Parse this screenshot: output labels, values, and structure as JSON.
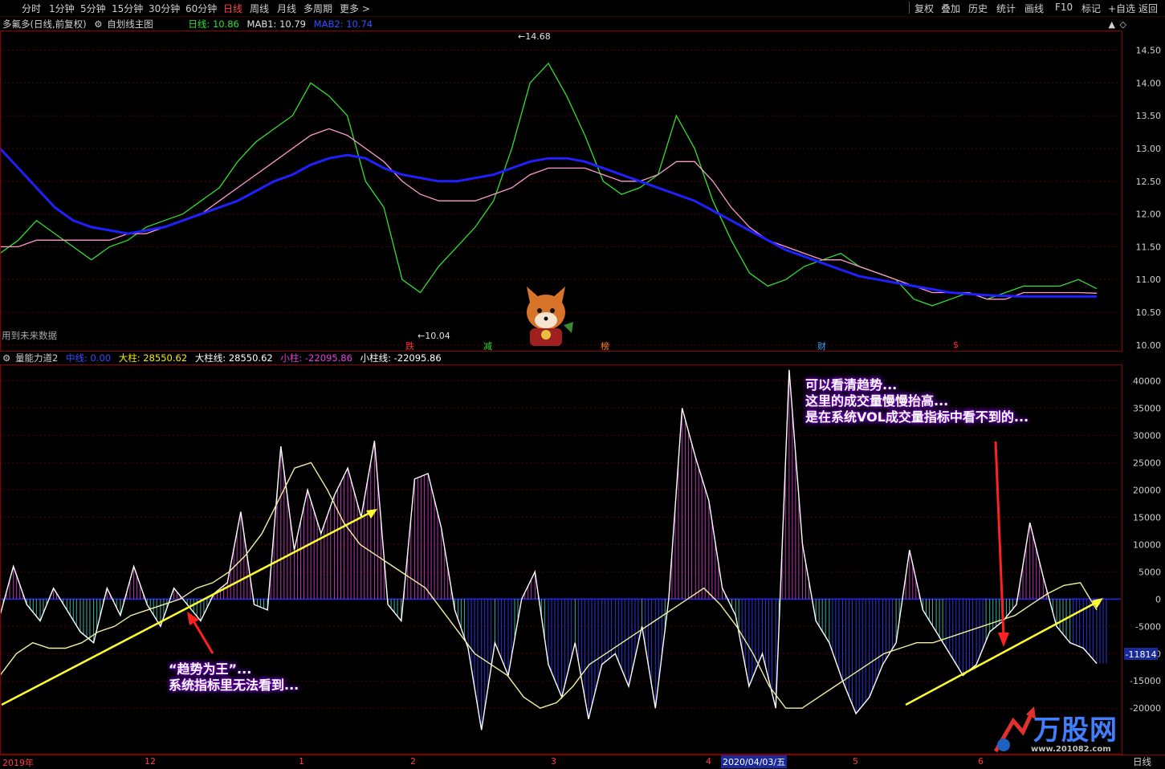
{
  "toolbar": {
    "periods": [
      "分时",
      "1分钟",
      "5分钟",
      "15分钟",
      "30分钟",
      "60分钟",
      "日线",
      "周线",
      "月线",
      "多周期",
      "更多 >"
    ],
    "active_period": "日线",
    "right_buttons": [
      "复权",
      "叠加",
      "历史",
      "统计",
      "画线",
      "F10",
      "标记",
      "+自选",
      "返回"
    ]
  },
  "stock": {
    "name": "多氟多(日线,前复权)",
    "main_indicator": "自划线主图",
    "line_label": "日线:",
    "line_value": "10.86",
    "mab1_label": "MAB1:",
    "mab1_value": "10.79",
    "mab2_label": "MAB2:",
    "mab2_value": "10.74",
    "future_data_note": "用到未来数据",
    "high_marker": "14.68",
    "low_marker": "10.04",
    "signals": [
      {
        "label": "跌",
        "color": "#ff3030"
      },
      {
        "label": "减",
        "color": "#30e030"
      },
      {
        "label": "榜",
        "color": "#ff8020"
      },
      {
        "label": "财",
        "color": "#40a0ff"
      },
      {
        "label": "$",
        "color": "#ff3030"
      }
    ]
  },
  "sub_indicator": {
    "name": "量能力道2",
    "zhong_label": "中线:",
    "zhong_value": "0.00",
    "dazhu_label": "大柱:",
    "dazhu_value": "28550.62",
    "dazhuxian_label": "大柱线:",
    "dazhuxian_value": "28550.62",
    "xiaozhu_label": "小柱:",
    "xiaozhu_value": "-22095.86",
    "xiaozhuxian_label": "小柱线:",
    "xiaozhuxian_value": "-22095.86",
    "current_value_tag": "-11814"
  },
  "annotations": {
    "left_line1": "“趋势为王”...",
    "left_line2": "系统指标里无法看到...",
    "right_line1": "可以看清趋势...",
    "right_line2": "这里的成交量慢慢抬高...",
    "right_line3": "是在系统VOL成交量指标中看不到的..."
  },
  "bottom_axis": {
    "labels": [
      "2019年",
      "12",
      "1",
      "2",
      "3",
      "4",
      "5",
      "6"
    ],
    "highlight_date": "2020/04/03/五",
    "period_label": "日线"
  },
  "watermark": {
    "brand": "万股网",
    "site": "www.201082.com"
  },
  "chart_data": [
    {
      "type": "line",
      "title": "多氟多(日线,前复权)",
      "y_axis_ticks": [
        "14.50",
        "14.00",
        "13.50",
        "13.00",
        "12.50",
        "12.00",
        "11.50",
        "11.00",
        "10.50",
        "10.00"
      ],
      "ylim": [
        9.9,
        14.8
      ],
      "series": [
        {
          "name": "日线",
          "color": "#30e030",
          "values": [
            11.4,
            11.6,
            11.9,
            11.7,
            11.5,
            11.3,
            11.5,
            11.6,
            11.8,
            11.9,
            12.0,
            12.2,
            12.4,
            12.8,
            13.1,
            13.3,
            13.5,
            14.0,
            13.8,
            13.5,
            12.5,
            12.1,
            11.0,
            10.8,
            11.2,
            11.5,
            11.8,
            12.2,
            13.0,
            14.0,
            14.3,
            13.8,
            13.2,
            12.5,
            12.3,
            12.4,
            12.6,
            13.5,
            13.0,
            12.2,
            11.6,
            11.1,
            10.9,
            11.0,
            11.2,
            11.3,
            11.4,
            11.2,
            11.1,
            11.0,
            10.7,
            10.6,
            10.7,
            10.8,
            10.7,
            10.8,
            10.9,
            10.9,
            10.9,
            11.0,
            10.86
          ]
        },
        {
          "name": "MAB1",
          "color": "#ff9ad0",
          "values": [
            11.5,
            11.5,
            11.6,
            11.6,
            11.6,
            11.6,
            11.6,
            11.7,
            11.7,
            11.8,
            11.9,
            12.0,
            12.2,
            12.4,
            12.6,
            12.8,
            13.0,
            13.2,
            13.3,
            13.2,
            13.0,
            12.8,
            12.5,
            12.3,
            12.2,
            12.2,
            12.2,
            12.3,
            12.4,
            12.6,
            12.7,
            12.7,
            12.7,
            12.6,
            12.5,
            12.5,
            12.6,
            12.8,
            12.8,
            12.5,
            12.1,
            11.8,
            11.6,
            11.5,
            11.4,
            11.3,
            11.3,
            11.2,
            11.1,
            11.0,
            10.9,
            10.8,
            10.8,
            10.8,
            10.7,
            10.7,
            10.8,
            10.8,
            10.8,
            10.8,
            10.79
          ]
        },
        {
          "name": "MAB2",
          "color": "#2020ff",
          "values": [
            13.0,
            12.7,
            12.4,
            12.1,
            11.9,
            11.8,
            11.75,
            11.7,
            11.75,
            11.8,
            11.9,
            12.0,
            12.1,
            12.2,
            12.35,
            12.5,
            12.6,
            12.75,
            12.85,
            12.9,
            12.85,
            12.7,
            12.6,
            12.55,
            12.5,
            12.5,
            12.55,
            12.6,
            12.7,
            12.8,
            12.85,
            12.85,
            12.8,
            12.7,
            12.6,
            12.5,
            12.4,
            12.3,
            12.2,
            12.05,
            11.9,
            11.75,
            11.6,
            11.45,
            11.35,
            11.25,
            11.15,
            11.05,
            11.0,
            10.95,
            10.9,
            10.85,
            10.8,
            10.78,
            10.76,
            10.75,
            10.74,
            10.74,
            10.74,
            10.74,
            10.74
          ]
        }
      ]
    },
    {
      "type": "bar",
      "title": "量能力道2",
      "y_axis_ticks": [
        "40000",
        "35000",
        "30000",
        "25000",
        "20000",
        "15000",
        "10000",
        "5000",
        "0",
        "-5000",
        "-10000",
        "-15000",
        "-20000"
      ],
      "ylim": [
        -28500,
        43000
      ],
      "series": [
        {
          "name": "大柱线",
          "color": "#ffffff",
          "values": [
            -3000,
            6000,
            -1000,
            -4000,
            2000,
            -2000,
            -6000,
            -8000,
            2000,
            -3000,
            6000,
            -1000,
            -5000,
            2000,
            -1000,
            -4000,
            1000,
            3000,
            16000,
            -1000,
            -2000,
            28000,
            9000,
            20000,
            12000,
            19000,
            24000,
            15000,
            29000,
            -1000,
            -4000,
            22000,
            23000,
            13000,
            -2000,
            -9000,
            -24000,
            -8000,
            -14000,
            0,
            5000,
            -12000,
            -18000,
            -8000,
            -22000,
            -12000,
            -10000,
            -16000,
            -5000,
            -20000,
            0,
            35000,
            26000,
            18000,
            2000,
            -3000,
            -16000,
            -10000,
            -20000,
            42000,
            10000,
            -4000,
            -8000,
            -15000,
            -21000,
            -18000,
            -12000,
            -8000,
            9000,
            -2000,
            -6000,
            -10000,
            -14000,
            -12000,
            -6000,
            -4000,
            -1000,
            14000,
            4000,
            -5000,
            -8000,
            -9000,
            -11814
          ]
        },
        {
          "name": "小柱线",
          "color": "#f0f0a0",
          "values": [
            -14000,
            -10000,
            -8000,
            -9000,
            -9000,
            -8000,
            -6000,
            -5000,
            -3000,
            -2000,
            -1000,
            0,
            2000,
            3000,
            5000,
            8000,
            12000,
            18000,
            24000,
            25000,
            20000,
            14000,
            10000,
            8000,
            6000,
            4000,
            2000,
            -2000,
            -6000,
            -10000,
            -12000,
            -14000,
            -18000,
            -20000,
            -19000,
            -16000,
            -12000,
            -10000,
            -8000,
            -6000,
            -4000,
            -2000,
            0,
            2000,
            -1000,
            -5000,
            -10000,
            -16000,
            -20000,
            -20000,
            -18000,
            -16000,
            -14000,
            -12000,
            -10000,
            -9000,
            -8000,
            -8000,
            -7000,
            -6000,
            -5000,
            -4000,
            -3000,
            -1000,
            1000,
            2500,
            3000,
            -2000
          ]
        }
      ]
    }
  ]
}
